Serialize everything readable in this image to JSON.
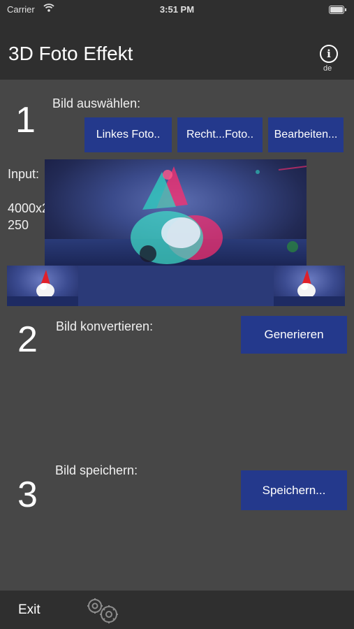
{
  "status_bar": {
    "carrier": "Carrier",
    "time": "3:51 PM"
  },
  "nav": {
    "title": "3D Foto Effekt",
    "info_label": "i",
    "language": "de"
  },
  "step1": {
    "number": "1",
    "label": "Bild auswählen:",
    "buttons": {
      "left_photo": "Linkes Foto..",
      "right_photo": "Recht...Foto..",
      "edit": "Bearbeiten..."
    },
    "input_label": "Input:",
    "resolution_line1": "4000x2",
    "resolution_line2": "250"
  },
  "step2": {
    "number": "2",
    "label": "Bild konvertieren:",
    "button": "Generieren"
  },
  "step3": {
    "number": "3",
    "label": "Bild speichern:",
    "button": "Speichern..."
  },
  "bottom_bar": {
    "exit_label": "Exit"
  },
  "icons": [
    "wifi-icon",
    "battery-icon",
    "info-icon",
    "gears-icon"
  ],
  "colors": {
    "background": "#474747",
    "bar": "#2f2f2f",
    "button": "#24398c"
  }
}
